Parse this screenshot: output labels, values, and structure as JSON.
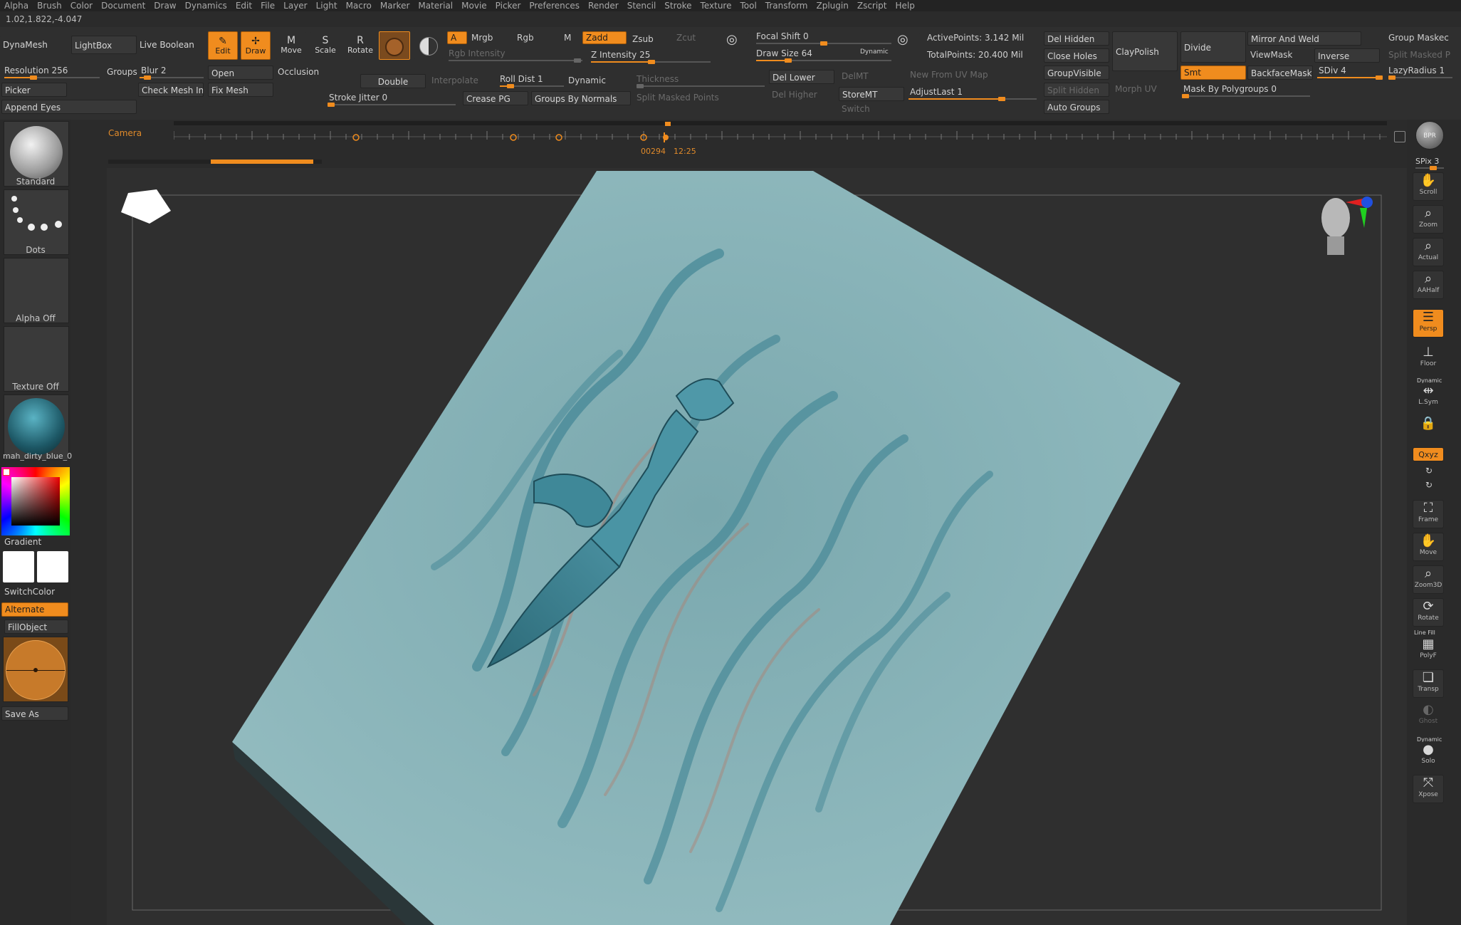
{
  "menu": [
    "Alpha",
    "Brush",
    "Color",
    "Document",
    "Draw",
    "Dynamics",
    "Edit",
    "File",
    "Layer",
    "Light",
    "Macro",
    "Marker",
    "Material",
    "Movie",
    "Picker",
    "Preferences",
    "Render",
    "Stencil",
    "Stroke",
    "Texture",
    "Tool",
    "Transform",
    "Zplugin",
    "Zscript",
    "Help"
  ],
  "coord_readout": "1.02,1.822,-4.047",
  "shelf": {
    "dynamesh": "DynaMesh",
    "lightbox": "LightBox",
    "live_boolean": "Live Boolean",
    "edit": "Edit",
    "draw": "Draw",
    "move": "Move",
    "scale": "Scale",
    "rotate": "Rotate",
    "a": "A",
    "mrgb": "Mrgb",
    "rgb": "Rgb",
    "m": "M",
    "rgb_intensity": "Rgb Intensity",
    "zadd": "Zadd",
    "zsub": "Zsub",
    "zcut": "Zcut",
    "z_intensity": "Z Intensity 25",
    "focal_shift": "Focal Shift 0",
    "draw_size": "Draw Size 64",
    "dynamic_small": "Dynamic",
    "active_points": "ActivePoints: 3.142 Mil",
    "total_points": "TotalPoints: 20.400 Mil",
    "del_hidden": "Del Hidden",
    "close_holes": "Close Holes",
    "group_visible": "GroupVisible",
    "split_hidden": "Split Hidden",
    "auto_groups": "Auto Groups",
    "claypolish": "ClayPolish",
    "morph_uv": "Morph UV",
    "divide": "Divide",
    "smt": "Smt",
    "mask_by_polygroups": "Mask By Polygroups 0",
    "mirror_and_weld": "Mirror And Weld",
    "viewmask": "ViewMask",
    "inverse": "Inverse",
    "backfacemask": "BackfaceMask",
    "sdiv": "SDiv 4",
    "group_masked": "Group Maskec",
    "split_masked_p": "Split Masked P",
    "lazyradius": "LazyRadius 1",
    "resolution": "Resolution 256",
    "groups": "Groups",
    "blur": "Blur 2",
    "open": "Open",
    "occlusion": "Occlusion",
    "picker": "Picker",
    "check_mesh": "Check Mesh Inte",
    "fix_mesh": "Fix Mesh",
    "append_eyes": "Append Eyes",
    "double": "Double",
    "interpolate": "Interpolate",
    "roll_dist": "Roll Dist 1",
    "dynamic": "Dynamic",
    "thickness": "Thickness",
    "stroke_jitter": "Stroke Jitter 0",
    "crease_pg": "Crease PG",
    "groups_by_normals": "Groups By Normals",
    "split_masked_points": "Split Masked Points",
    "del_lower": "Del Lower",
    "del_higher": "Del Higher",
    "delmt": "DelMT",
    "storemt": "StoreMT",
    "switch": "Switch",
    "new_from_uv_map": "New From UV Map",
    "adjustlast": "AdjustLast 1"
  },
  "timeline": {
    "camera_label": "Camera",
    "frame_readout": "00294",
    "time_readout": "12:25"
  },
  "left": {
    "brush": "Standard",
    "stroke": "Dots",
    "alpha": "Alpha Off",
    "texture": "Texture Off",
    "material": "mah_dirty_blue_0",
    "gradient": "Gradient",
    "switchcolor": "SwitchColor",
    "alternate": "Alternate",
    "fillobject": "FillObject",
    "save_as": "Save As"
  },
  "right": {
    "bpr": "BPR",
    "spix": "SPix 3",
    "scroll": "Scroll",
    "zoom": "Zoom",
    "actual": "Actual",
    "aahalf": "AAHalf",
    "persp": "Persp",
    "floor": "Floor",
    "dynamic": "Dynamic",
    "lsym": "L.Sym",
    "xyz": "Qxyz",
    "frame": "Frame",
    "move": "Move",
    "zoom3d": "Zoom3D",
    "rotate": "Rotate",
    "line_fill": "Line Fill",
    "polyf": "PolyF",
    "transp": "Transp",
    "ghost": "Ghost",
    "dynamic2": "Dynamic",
    "solo": "Solo",
    "xpose": "Xpose"
  },
  "colors": {
    "accent": "#f08c1e",
    "panel": "#2a2a2a",
    "mesh": "#8ab4b8"
  }
}
